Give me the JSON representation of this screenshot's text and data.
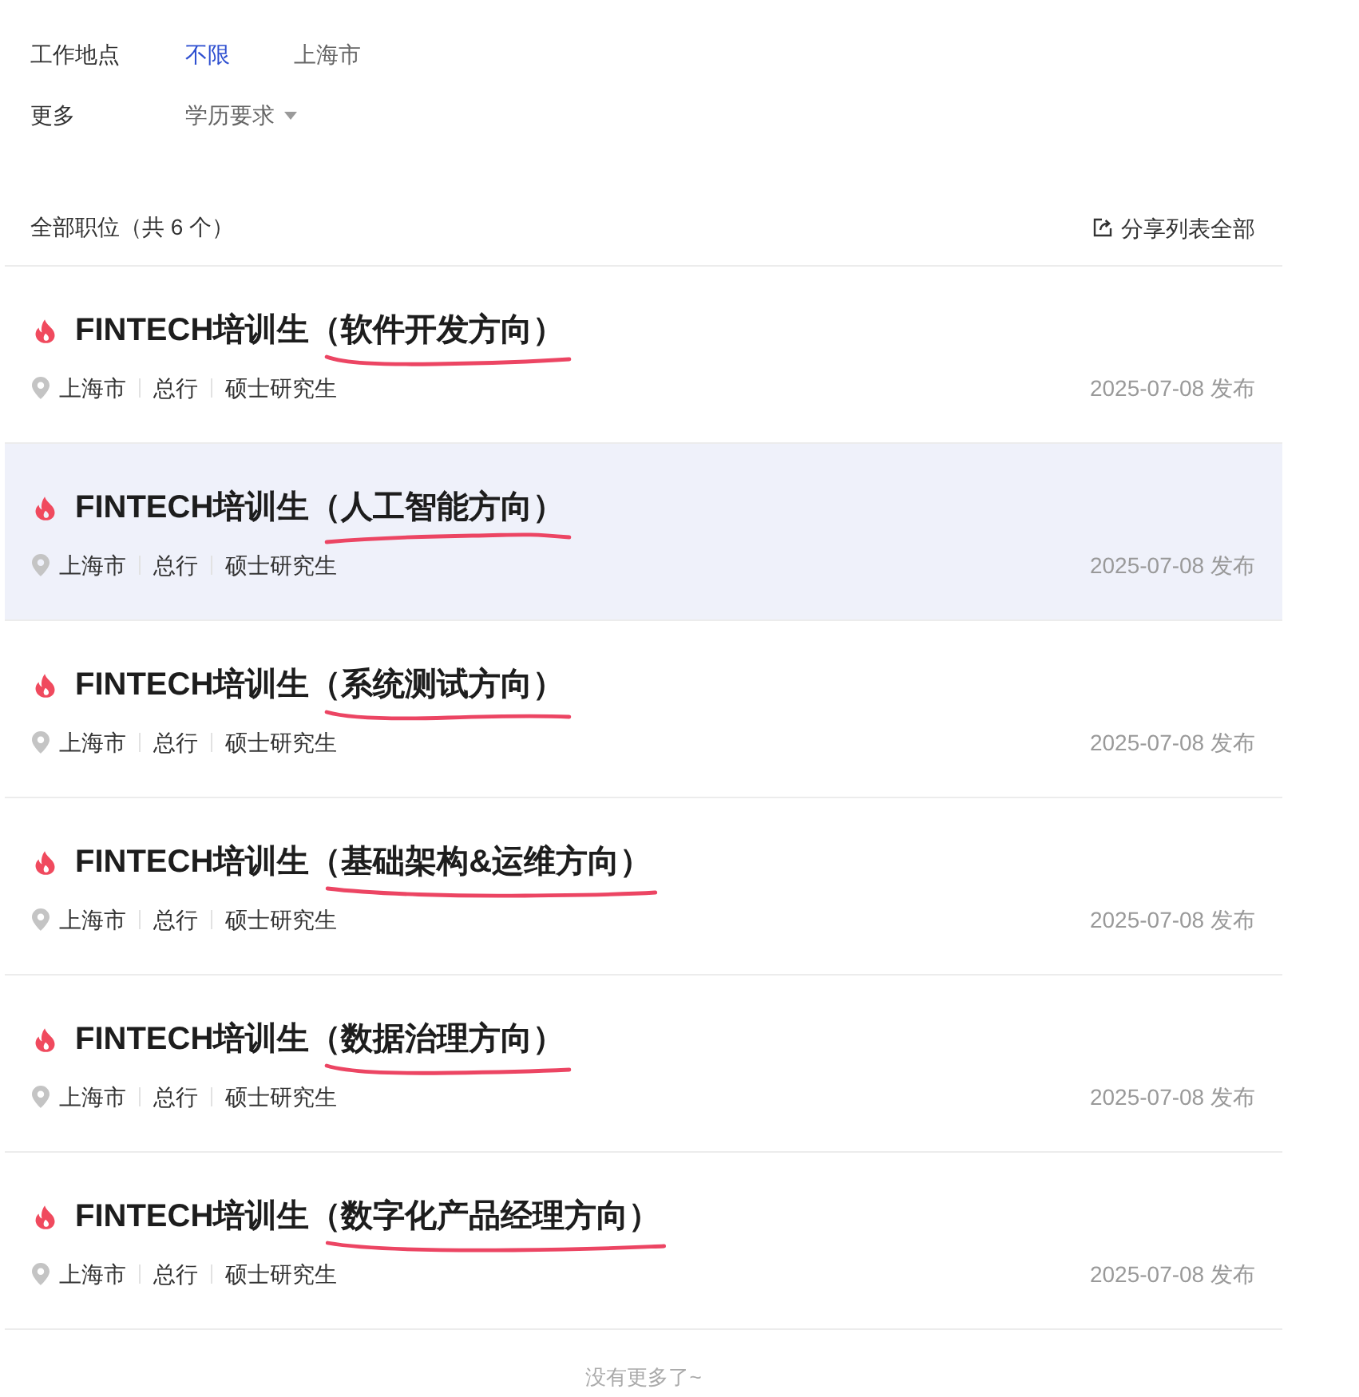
{
  "filters": [
    {
      "kind": "options",
      "label": "工作地点",
      "options": [
        {
          "label": "不限",
          "selected": true
        },
        {
          "label": "上海市",
          "selected": false
        }
      ]
    },
    {
      "kind": "dropdown",
      "label": "更多",
      "dropdowns": [
        "学历要求"
      ]
    }
  ],
  "list_header": {
    "title": "全部职位（共 6 个）",
    "share_link": "分享列表全部"
  },
  "jobs": [
    {
      "title": "FINTECH培训生",
      "direction": "（软件开发方向）",
      "hot": true,
      "underlined": true,
      "hovered": false,
      "tags": [
        "上海市",
        "总行",
        "硕士研究生"
      ],
      "date": "2025-07-08 发布"
    },
    {
      "title": "FINTECH培训生",
      "direction": "（人工智能方向）",
      "hot": true,
      "underlined": true,
      "hovered": true,
      "tags": [
        "上海市",
        "总行",
        "硕士研究生"
      ],
      "date": "2025-07-08 发布"
    },
    {
      "title": "FINTECH培训生",
      "direction": "（系统测试方向）",
      "hot": true,
      "underlined": true,
      "hovered": false,
      "tags": [
        "上海市",
        "总行",
        "硕士研究生"
      ],
      "date": "2025-07-08 发布"
    },
    {
      "title": "FINTECH培训生",
      "direction": "（基础架构&运维方向）",
      "hot": true,
      "underlined": true,
      "hovered": false,
      "tags": [
        "上海市",
        "总行",
        "硕士研究生"
      ],
      "date": "2025-07-08 发布"
    },
    {
      "title": "FINTECH培训生",
      "direction": "（数据治理方向）",
      "hot": true,
      "underlined": true,
      "hovered": false,
      "tags": [
        "上海市",
        "总行",
        "硕士研究生"
      ],
      "date": "2025-07-08 发布"
    },
    {
      "title": "FINTECH培训生",
      "direction": "（数字化产品经理方向）",
      "hot": true,
      "underlined": true,
      "hovered": false,
      "tags": [
        "上海市",
        "总行",
        "硕士研究生"
      ],
      "date": "2025-07-08 发布"
    }
  ],
  "footer": "没有更多了~"
}
